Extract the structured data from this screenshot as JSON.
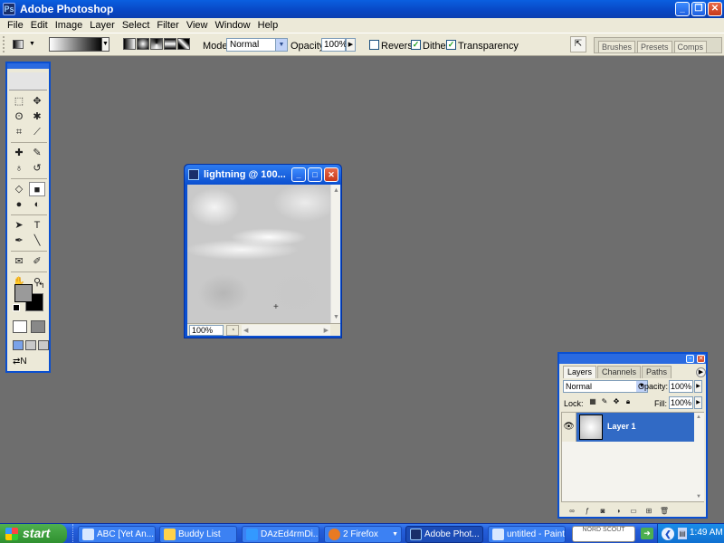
{
  "app": {
    "title": "Adobe Photoshop"
  },
  "menu": [
    "File",
    "Edit",
    "Image",
    "Layer",
    "Select",
    "Filter",
    "View",
    "Window",
    "Help"
  ],
  "options": {
    "mode_label": "Mode:",
    "mode_value": "Normal",
    "opacity_label": "Opacity:",
    "opacity_value": "100%",
    "reverse_label": "Reverse",
    "reverse_checked": false,
    "dither_label": "Dither",
    "dither_checked": true,
    "transparency_label": "Transparency",
    "transparency_checked": true,
    "gradient_types": [
      "linear",
      "radial",
      "angle",
      "reflected",
      "diamond"
    ],
    "selected_gradient_type": "linear"
  },
  "palette_well": {
    "tabs": [
      "Brushes",
      "Presets",
      "Comps"
    ]
  },
  "toolbox": {
    "tools": [
      {
        "name": "marquee",
        "glyph": "⬚"
      },
      {
        "name": "move",
        "glyph": "✥"
      },
      {
        "name": "lasso",
        "glyph": "ʘ"
      },
      {
        "name": "magic-wand",
        "glyph": "✱"
      },
      {
        "name": "crop",
        "glyph": "⌗"
      },
      {
        "name": "slice",
        "glyph": "⟋"
      },
      {
        "name": "healing-brush",
        "glyph": "✚"
      },
      {
        "name": "brush",
        "glyph": "✎"
      },
      {
        "name": "clone-stamp",
        "glyph": "♁"
      },
      {
        "name": "history-brush",
        "glyph": "↺"
      },
      {
        "name": "eraser",
        "glyph": "◇"
      },
      {
        "name": "gradient",
        "glyph": "■"
      },
      {
        "name": "blur",
        "glyph": "●"
      },
      {
        "name": "dodge",
        "glyph": "◐"
      },
      {
        "name": "path-selection",
        "glyph": "➤"
      },
      {
        "name": "type",
        "glyph": "T"
      },
      {
        "name": "pen",
        "glyph": "✒"
      },
      {
        "name": "line",
        "glyph": "╲"
      },
      {
        "name": "notes",
        "glyph": "✉"
      },
      {
        "name": "eyedropper",
        "glyph": "✐"
      },
      {
        "name": "hand",
        "glyph": "✋"
      },
      {
        "name": "zoom",
        "glyph": "⚲"
      }
    ],
    "active_tool": "gradient",
    "foreground_color": "#9a9a9a",
    "background_color": "#000000"
  },
  "document": {
    "title": "lightning @ 100...",
    "zoom": "100%"
  },
  "layers": {
    "tabs": [
      "Layers",
      "Channels",
      "Paths"
    ],
    "active_tab": "Layers",
    "blend_mode": "Normal",
    "opacity_label": "Opacity:",
    "opacity_value": "100%",
    "lock_label": "Lock:",
    "fill_label": "Fill:",
    "fill_value": "100%",
    "items": [
      {
        "name": "Layer 1",
        "visible": true,
        "selected": true
      }
    ]
  },
  "taskbar": {
    "start_label": "start",
    "buttons": [
      {
        "label": "ABC [Yet An...",
        "icon_color": "#d9e8ff",
        "active": false
      },
      {
        "label": "Buddy List",
        "icon_color": "#ffd24a",
        "active": false
      },
      {
        "label": "DAzEd4rmDi...",
        "icon_color": "#3399ff",
        "active": false
      },
      {
        "label": "2 Firefox",
        "icon_color": "#e87a22",
        "active": false
      },
      {
        "label": "Adobe Phot...",
        "icon_color": "#1a2f6a",
        "active": true
      },
      {
        "label": "untitled - Paint",
        "icon_color": "#d9e8ff",
        "active": false
      }
    ],
    "toolbar_logo": "NORD SCOUT",
    "clock": "1:49 AM"
  },
  "colors": {
    "desktop": "#6e6e6e",
    "titlebar": "#0a4fd0",
    "selection": "#316ac5"
  }
}
